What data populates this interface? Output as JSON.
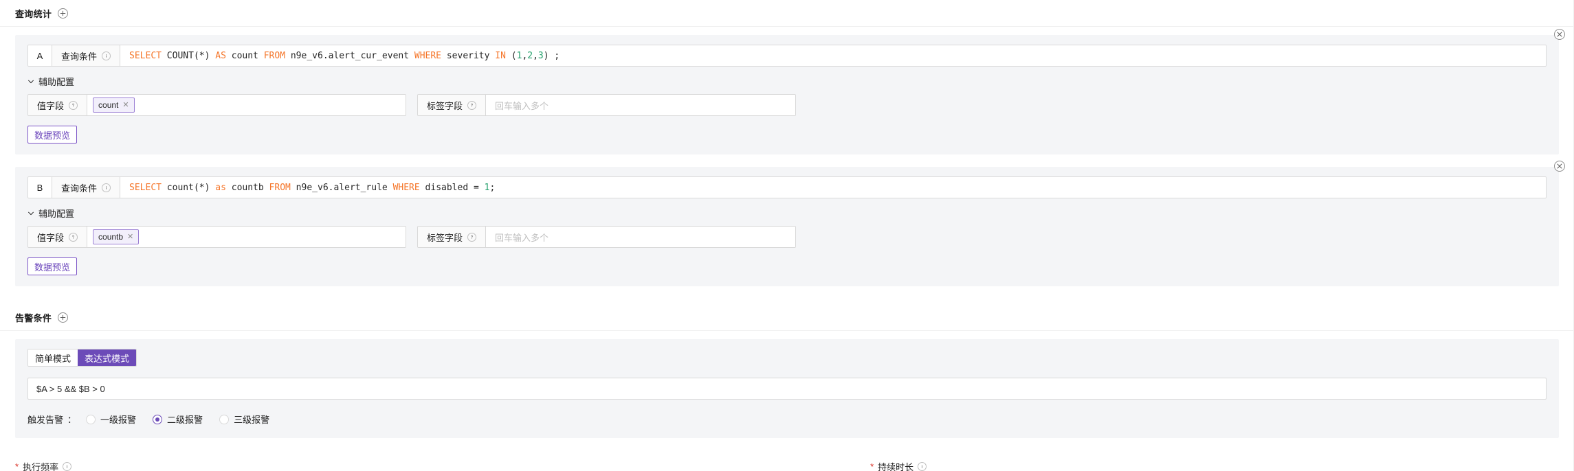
{
  "query_stats": {
    "title": "查询统计",
    "add_icon": "plus-circle-icon",
    "queries": [
      {
        "ref": "A",
        "condition_label": "查询条件",
        "info_icon": "info-circle-icon",
        "close_icon": "close-circle-icon",
        "sql_tokens": [
          {
            "t": "SELECT",
            "c": "kw"
          },
          {
            "t": " COUNT(*) ",
            "c": ""
          },
          {
            "t": "AS",
            "c": "kw"
          },
          {
            "t": " count ",
            "c": ""
          },
          {
            "t": "FROM",
            "c": "kw"
          },
          {
            "t": " n9e_v6.alert_cur_event ",
            "c": ""
          },
          {
            "t": "WHERE",
            "c": "kw"
          },
          {
            "t": " severity ",
            "c": ""
          },
          {
            "t": "IN",
            "c": "kw"
          },
          {
            "t": " (",
            "c": ""
          },
          {
            "t": "1",
            "c": "num"
          },
          {
            "t": ",",
            "c": ""
          },
          {
            "t": "2",
            "c": "num"
          },
          {
            "t": ",",
            "c": ""
          },
          {
            "t": "3",
            "c": "num"
          },
          {
            "t": ") ;",
            "c": ""
          }
        ],
        "sql_plain": "SELECT COUNT(*) AS count FROM n9e_v6.alert_cur_event WHERE severity IN (1,2,3) ;",
        "aux_label": "辅助配置",
        "value_field_label": "值字段",
        "value_field_tag": "count",
        "tag_field_label": "标签字段",
        "tag_field_placeholder": "回车输入多个",
        "preview_button": "数据预览"
      },
      {
        "ref": "B",
        "condition_label": "查询条件",
        "info_icon": "info-circle-icon",
        "close_icon": "close-circle-icon",
        "sql_tokens": [
          {
            "t": "SELECT",
            "c": "kw"
          },
          {
            "t": " count(*) ",
            "c": ""
          },
          {
            "t": "as",
            "c": "kw"
          },
          {
            "t": " countb ",
            "c": ""
          },
          {
            "t": "FROM",
            "c": "kw"
          },
          {
            "t": " n9e_v6.alert_rule ",
            "c": ""
          },
          {
            "t": "WHERE",
            "c": "kw"
          },
          {
            "t": " disabled = ",
            "c": ""
          },
          {
            "t": "1",
            "c": "num"
          },
          {
            "t": ";",
            "c": ""
          }
        ],
        "sql_plain": "SELECT count(*) as countb FROM n9e_v6.alert_rule WHERE disabled = 1;",
        "aux_label": "辅助配置",
        "value_field_label": "值字段",
        "value_field_tag": "countb",
        "tag_field_label": "标签字段",
        "tag_field_placeholder": "回车输入多个",
        "preview_button": "数据预览"
      }
    ]
  },
  "alert_condition": {
    "title": "告警条件",
    "add_icon": "plus-circle-icon",
    "modes": [
      {
        "label": "简单模式",
        "active": false
      },
      {
        "label": "表达式模式",
        "active": true
      }
    ],
    "expression": "$A > 5 && $B > 0",
    "trigger_label": "触发告警",
    "trigger_colon": "：",
    "levels": [
      {
        "label": "一级报警",
        "checked": false
      },
      {
        "label": "二级报警",
        "checked": true
      },
      {
        "label": "三级报警",
        "checked": false
      }
    ]
  },
  "bottom_partial": {
    "left_label": "执行频率",
    "left_star": "*",
    "left_info_icon": "info-circle-icon",
    "right_label": "持续时长",
    "right_star": "*",
    "right_info_icon": "info-circle-icon"
  },
  "colors": {
    "accent": "#6c4bb8",
    "accent_border": "#7a52c7",
    "sql_keyword": "#f5762a",
    "sql_number": "#22a06b",
    "card_bg": "#f4f5f7",
    "border": "#d9d9d9",
    "addon_bg": "#fafafa",
    "placeholder": "#bfbfbf"
  }
}
